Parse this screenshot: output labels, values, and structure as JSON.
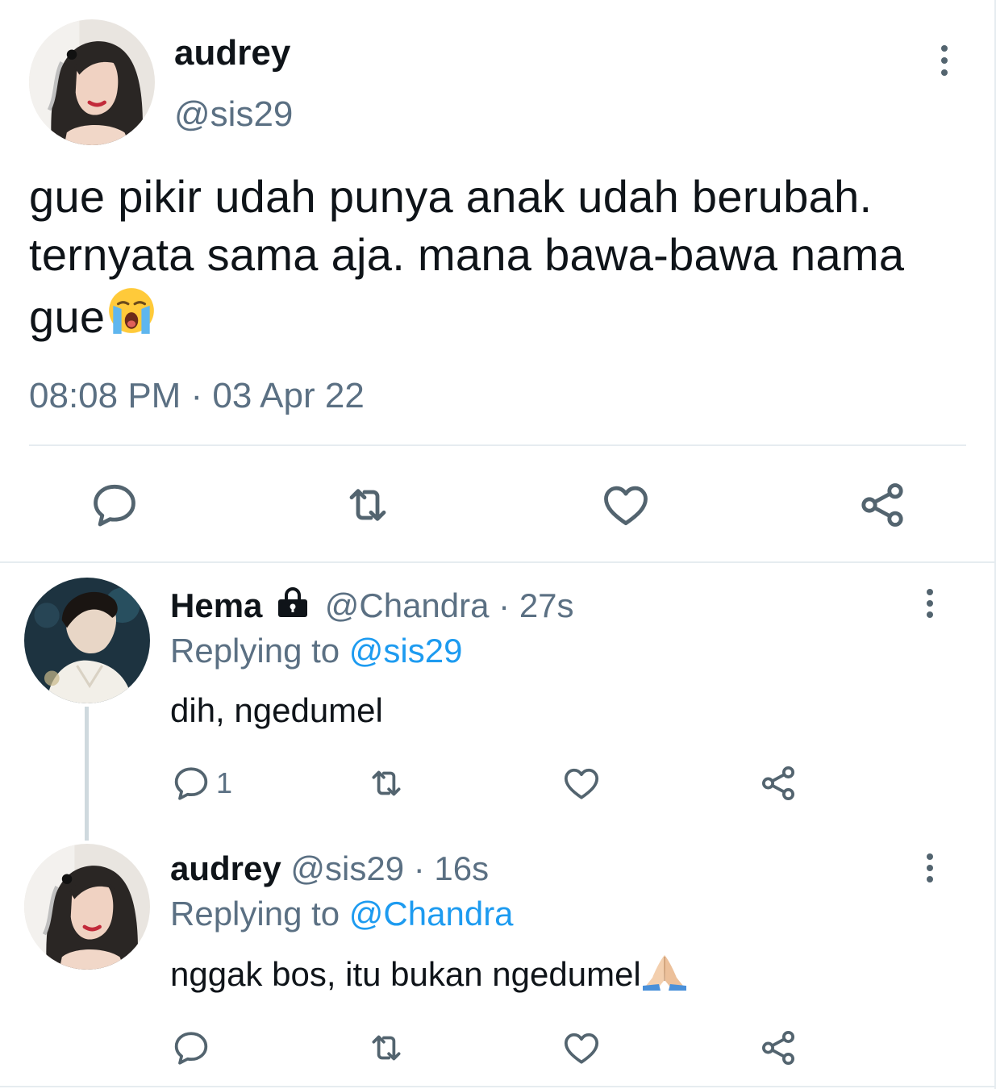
{
  "main_tweet": {
    "display_name": "audrey",
    "handle": "@sis29",
    "text": "gue pikir udah punya anak udah berubah. ternyata sama aja. mana bawa-bawa nama gue",
    "text_emoji": "loudly-crying-face",
    "timestamp": "08:08 PM · 03 Apr 22"
  },
  "replies": [
    {
      "display_name": "Hema",
      "locked": true,
      "handle": "@Chandra",
      "time": "· 27s",
      "replying_prefix": "Replying to",
      "replying_to": "@sis29",
      "text": "dih, ngedumel",
      "reply_count": "1"
    },
    {
      "display_name": "audrey",
      "handle": "@sis29",
      "time": "· 16s",
      "replying_prefix": "Replying to",
      "replying_to": "@Chandra",
      "text": "nggak bos, itu bukan ngedumel",
      "text_emoji": "folded-hands",
      "reply_count": ""
    }
  ],
  "icons": [
    "more-vertical-icon",
    "reply-icon",
    "retweet-icon",
    "like-icon",
    "share-icon",
    "lock-icon"
  ],
  "colors": {
    "text": "#0f1419",
    "secondary": "#5b7083",
    "link": "#1d9bf0",
    "divider": "#e6ecf0"
  }
}
